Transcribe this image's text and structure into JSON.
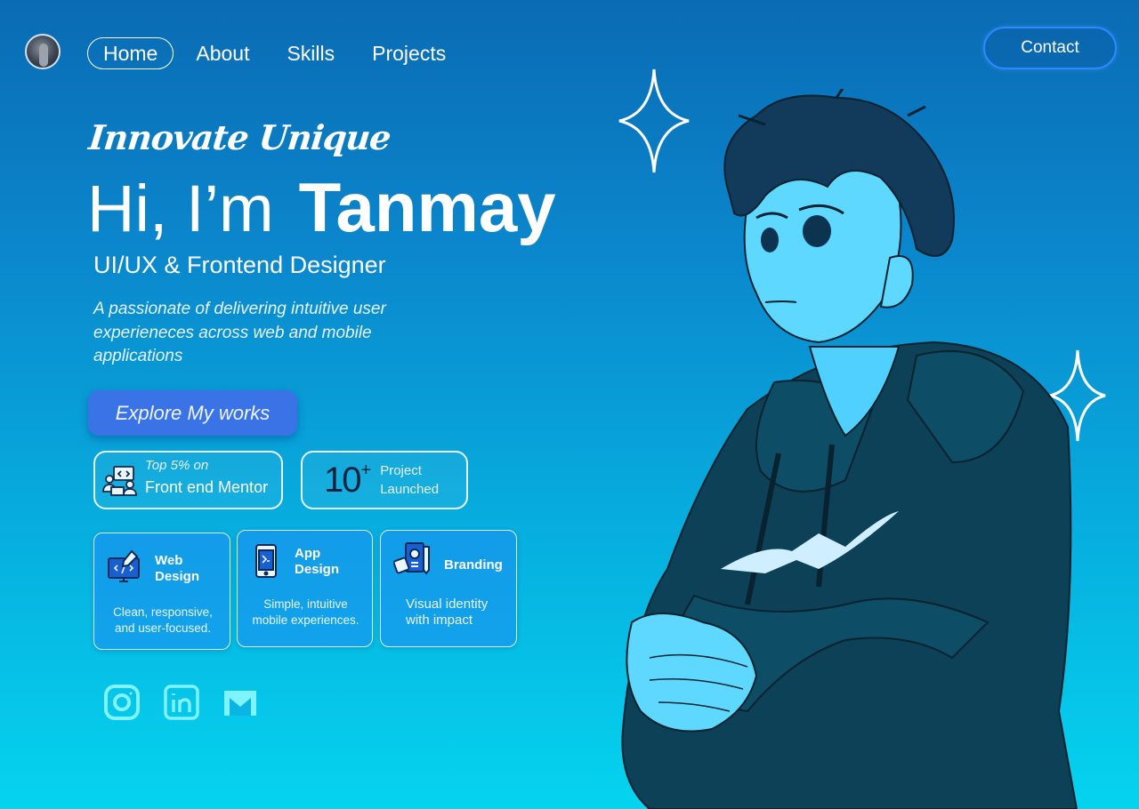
{
  "nav": {
    "items": [
      {
        "label": "Home",
        "active": true
      },
      {
        "label": "About",
        "active": false
      },
      {
        "label": "Skills",
        "active": false
      },
      {
        "label": "Projects",
        "active": false
      }
    ],
    "contact_label": "Contact"
  },
  "hero": {
    "tagline": "Innovate Unique",
    "greeting": "Hi, I’m",
    "name": "Tanmay",
    "role": "UI/UX & Frontend Designer",
    "description": "A  passionate of delivering intuitive user experieneces across web and mobile applications",
    "cta_label": "Explore My works"
  },
  "stats": {
    "mentor": {
      "small": "Top 5% on",
      "big": "Front end Mentor",
      "icon": "team-laptop-icon"
    },
    "projects": {
      "number": "10",
      "suffix": "+",
      "line1": "Project",
      "line2": "Launched"
    }
  },
  "services": [
    {
      "title_line1": "Web",
      "title_line2": "Design",
      "desc_line1": "Clean, responsive,",
      "desc_line2": "and user-focused.",
      "icon": "web-design-icon"
    },
    {
      "title_line1": "App",
      "title_line2": "Design",
      "desc_line1": "Simple, intuitive",
      "desc_line2": "mobile experiences.",
      "icon": "app-design-icon"
    },
    {
      "title_line1": "Branding",
      "title_line2": "",
      "desc_line1": "Visual identity",
      "desc_line2": "with impact",
      "icon": "branding-icon"
    }
  ],
  "social": [
    {
      "icon": "instagram-icon"
    },
    {
      "icon": "linkedin-icon"
    },
    {
      "icon": "gmail-icon"
    }
  ],
  "colors": {
    "accent": "#3a73e6",
    "contact_border": "#2f88ff",
    "bg_top": "#0a6bb3",
    "bg_bottom": "#05d4ef",
    "social_icon": "#7ff3ff"
  }
}
